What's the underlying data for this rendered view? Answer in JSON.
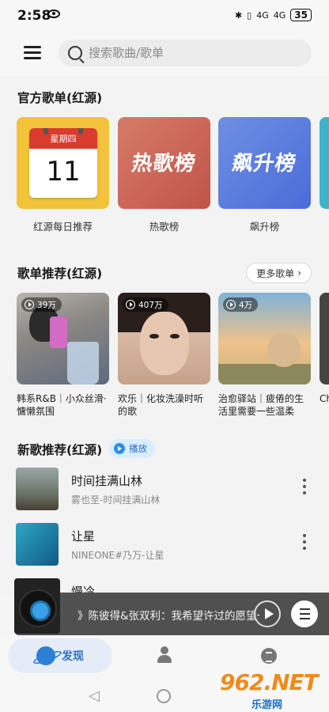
{
  "status_bar": {
    "time": "2:58",
    "signal_1": "4G",
    "signal_2": "4G",
    "battery": "35"
  },
  "header": {
    "search_placeholder": "搜索歌曲/歌单"
  },
  "official": {
    "title": "官方歌单(红源)",
    "items": [
      {
        "label": "红源每日推荐",
        "calendar_weekday": "星期四",
        "calendar_day": "11"
      },
      {
        "label": "热歌榜",
        "cover_text": "热歌榜"
      },
      {
        "label": "飙升榜",
        "cover_text": "飙升榜"
      }
    ]
  },
  "recommend": {
    "title": "歌单推荐(红源)",
    "more_label": "更多歌单",
    "items": [
      {
        "plays": "39万",
        "label": "韩系R&B｜小众丝滑·慵懒氛围"
      },
      {
        "plays": "407万",
        "label": "欢乐｜化妆洗澡时听的歌"
      },
      {
        "plays": "4万",
        "label": "治愈驿站｜疲倦的生活里需要一些温柔"
      }
    ],
    "peek_label": "Ch"
  },
  "new_songs": {
    "title": "新歌推荐(红源)",
    "play_label": "播放",
    "songs": [
      {
        "title": "时间挂满山林",
        "artist": "雾也至-时间挂满山林"
      },
      {
        "title": "让星",
        "artist": "NINEONE#乃万-让星"
      },
      {
        "title": "慢冷",
        "artist": ""
      }
    ]
  },
  "player": {
    "now_playing": "》陈彼得&张双利：我希望许过的愿望一样"
  },
  "bottom_nav": {
    "discover_label": "发现"
  },
  "watermark": {
    "big": "962.NET",
    "small": "乐游网"
  }
}
